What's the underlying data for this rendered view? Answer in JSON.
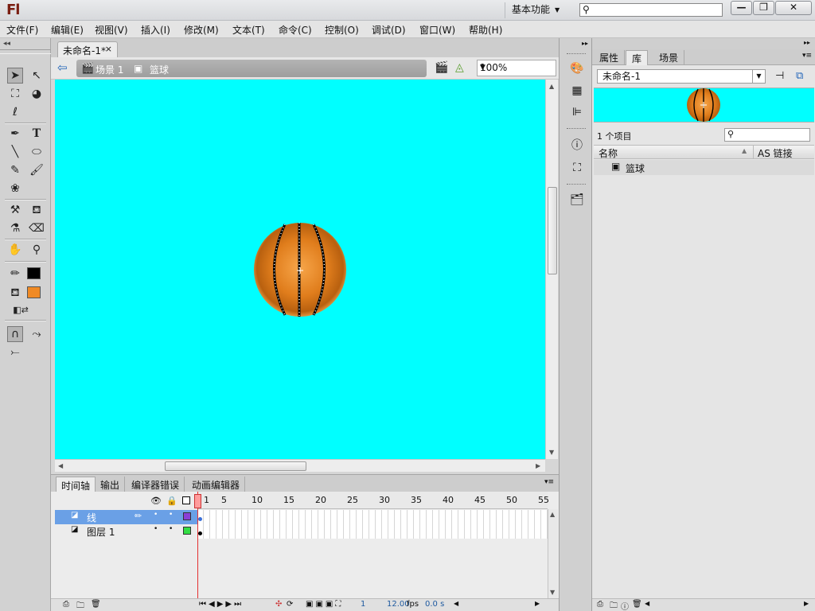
{
  "app": {
    "logo": "Fl",
    "workspace": "基本功能",
    "search_placeholder": "",
    "window_buttons": {
      "min": "—",
      "max": "❐",
      "close": "✕"
    }
  },
  "menu": [
    "文件(F)",
    "编辑(E)",
    "视图(V)",
    "插入(I)",
    "修改(M)",
    "文本(T)",
    "命令(C)",
    "控制(O)",
    "调试(D)",
    "窗口(W)",
    "帮助(H)"
  ],
  "document": {
    "tab_label": "未命名-1*",
    "close_label": "×",
    "breadcrumbs": [
      "场景 1",
      "篮球"
    ],
    "zoom": "100%",
    "stage_color": "#00ffff"
  },
  "tools": {
    "stroke_color": "#000000",
    "fill_color": "#f08a24"
  },
  "timeline": {
    "tabs": [
      "时间轴",
      "输出",
      "编译器错误",
      "动画编辑器"
    ],
    "ruler_numbers": [
      "1",
      "5",
      "10",
      "15",
      "20",
      "25",
      "30",
      "35",
      "40",
      "45",
      "50",
      "55"
    ],
    "layers": [
      {
        "name": "线",
        "color": "#8a3fd6",
        "selected": true
      },
      {
        "name": "图层 1",
        "color": "#33dd44",
        "selected": false
      }
    ],
    "status": {
      "current_frame": "1",
      "fps": "12.00",
      "fps_unit": "fps",
      "time": "0.0 s"
    }
  },
  "library": {
    "tabs": [
      "属性",
      "库",
      "场景"
    ],
    "active_tab": "库",
    "document_select": "未命名-1",
    "item_count": "1 个项目",
    "columns": {
      "name": "名称",
      "linkage": "AS 链接"
    },
    "items": [
      {
        "name": "篮球"
      }
    ]
  }
}
